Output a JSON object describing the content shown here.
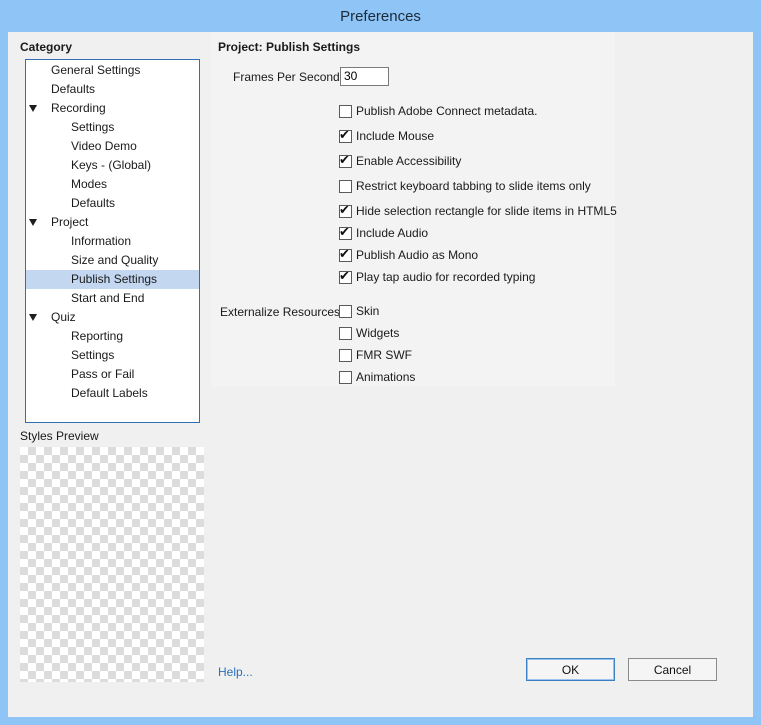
{
  "window": {
    "title": "Preferences"
  },
  "category": {
    "header": "Category",
    "items": [
      {
        "label": "General Settings",
        "level": 0,
        "expander": false,
        "selected": false
      },
      {
        "label": "Defaults",
        "level": 0,
        "expander": false,
        "selected": false
      },
      {
        "label": "Recording",
        "level": 0,
        "expander": true,
        "selected": false
      },
      {
        "label": "Settings",
        "level": 1,
        "expander": false,
        "selected": false
      },
      {
        "label": "Video Demo",
        "level": 1,
        "expander": false,
        "selected": false
      },
      {
        "label": "Keys - (Global)",
        "level": 1,
        "expander": false,
        "selected": false
      },
      {
        "label": "Modes",
        "level": 1,
        "expander": false,
        "selected": false
      },
      {
        "label": "Defaults",
        "level": 1,
        "expander": false,
        "selected": false
      },
      {
        "label": "Project",
        "level": 0,
        "expander": true,
        "selected": false
      },
      {
        "label": "Information",
        "level": 1,
        "expander": false,
        "selected": false
      },
      {
        "label": "Size and Quality",
        "level": 1,
        "expander": false,
        "selected": false
      },
      {
        "label": "Publish Settings",
        "level": 1,
        "expander": false,
        "selected": true
      },
      {
        "label": "Start and End",
        "level": 1,
        "expander": false,
        "selected": false
      },
      {
        "label": "Quiz",
        "level": 0,
        "expander": true,
        "selected": false
      },
      {
        "label": "Reporting",
        "level": 1,
        "expander": false,
        "selected": false
      },
      {
        "label": "Settings",
        "level": 1,
        "expander": false,
        "selected": false
      },
      {
        "label": "Pass or Fail",
        "level": 1,
        "expander": false,
        "selected": false
      },
      {
        "label": "Default Labels",
        "level": 1,
        "expander": false,
        "selected": false
      }
    ]
  },
  "styles_preview": {
    "header": "Styles Preview"
  },
  "panel": {
    "title": "Project: Publish Settings",
    "fps_label": "Frames Per Second:",
    "fps_value": "30",
    "options": [
      {
        "label": "Publish Adobe Connect metadata.",
        "checked": false
      },
      {
        "label": "Include Mouse",
        "checked": true
      },
      {
        "label": "Enable Accessibility",
        "checked": true
      },
      {
        "label": "Restrict keyboard tabbing to slide items only",
        "checked": false
      },
      {
        "label": "Hide selection rectangle for slide items in HTML5",
        "checked": true
      },
      {
        "label": "Include Audio",
        "checked": true
      },
      {
        "label": "Publish Audio as Mono",
        "checked": true
      },
      {
        "label": "Play tap audio for recorded typing",
        "checked": true
      }
    ],
    "externalize_label": "Externalize Resources:",
    "externalize": [
      {
        "label": "Skin",
        "checked": false
      },
      {
        "label": "Widgets",
        "checked": false
      },
      {
        "label": "FMR SWF",
        "checked": false
      },
      {
        "label": "Animations",
        "checked": false
      }
    ]
  },
  "footer": {
    "help": "Help...",
    "ok": "OK",
    "cancel": "Cancel"
  },
  "colors": {
    "titlebar": "#8fc4f6",
    "selection": "#c3d7f1",
    "tree_border": "#2f6fb4",
    "link": "#2a6fb8"
  },
  "icons": {
    "expander": "triangle-down-icon",
    "check": "checkmark-icon"
  }
}
